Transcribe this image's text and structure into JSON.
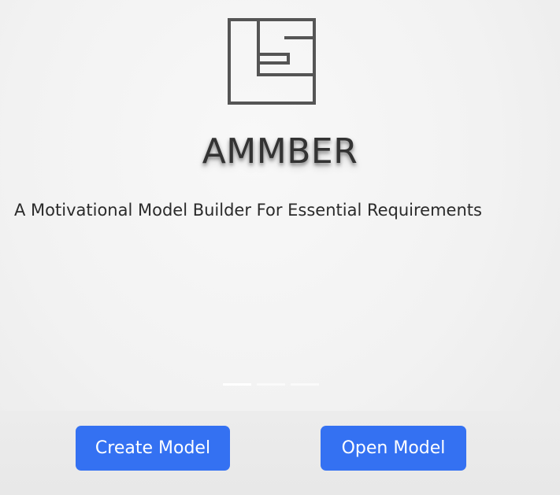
{
  "app": {
    "title": "AMMBER",
    "tagline": "A Motivational Model Builder For Essential Requirements",
    "logo_icon": "ammber-logo-icon"
  },
  "carousel": {
    "slide_count": 3,
    "active_index": 0
  },
  "actions": {
    "create_label": "Create Model",
    "open_label": "Open Model"
  },
  "colors": {
    "accent": "#3471f2",
    "title_text": "#333333",
    "logo_stroke": "#555555"
  }
}
